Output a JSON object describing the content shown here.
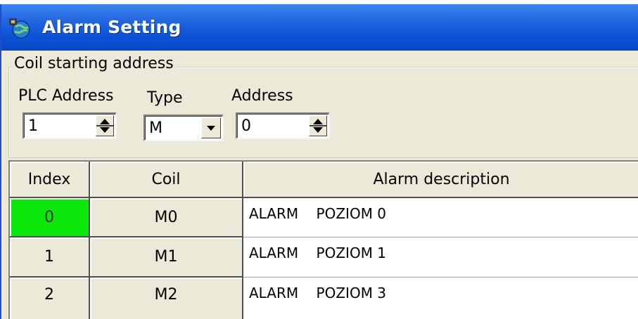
{
  "window": {
    "title": "Alarm Setting",
    "icon": "app-globe-icon"
  },
  "coil_group": {
    "legend": "Coil starting address",
    "plc_address": {
      "label": "PLC Address",
      "value": "1"
    },
    "type": {
      "label": "Type",
      "value": "M"
    },
    "address": {
      "label": "Address",
      "value": "0"
    }
  },
  "grid": {
    "headers": {
      "index": "Index",
      "coil": "Coil",
      "description": "Alarm description"
    },
    "rows": [
      {
        "index": "0",
        "coil": "M0",
        "description": "ALARM    POZIOM 0"
      },
      {
        "index": "1",
        "coil": "M1",
        "description": "ALARM    POZIOM 1"
      },
      {
        "index": "2",
        "coil": "M2",
        "description": "ALARM    POZIOM 3"
      }
    ]
  },
  "colors": {
    "titlebar": "#0b52d8",
    "selected_index": "#0ae60a",
    "face": "#ece9d8"
  }
}
